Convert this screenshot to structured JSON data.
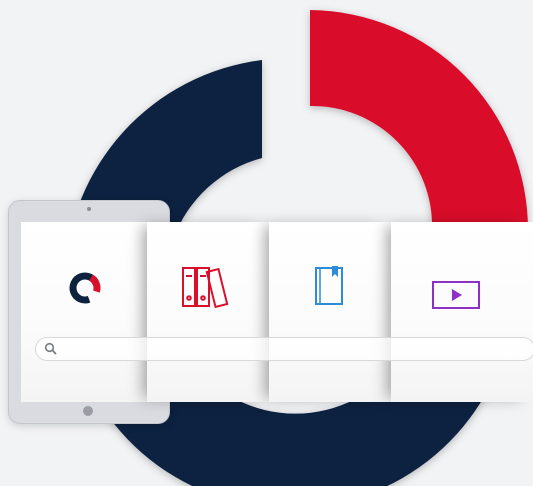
{
  "colors": {
    "navy": "#0e2240",
    "red": "#d9102c",
    "purple": "#8e2fc7",
    "blue": "#2d8bd8",
    "background": "#f2f3f5"
  },
  "icons": {
    "logo": "ring-logo-icon",
    "binders": "binders-icon",
    "document": "bookmarked-document-icon",
    "video": "video-play-icon",
    "search": "search-icon"
  },
  "search": {
    "value": ""
  }
}
